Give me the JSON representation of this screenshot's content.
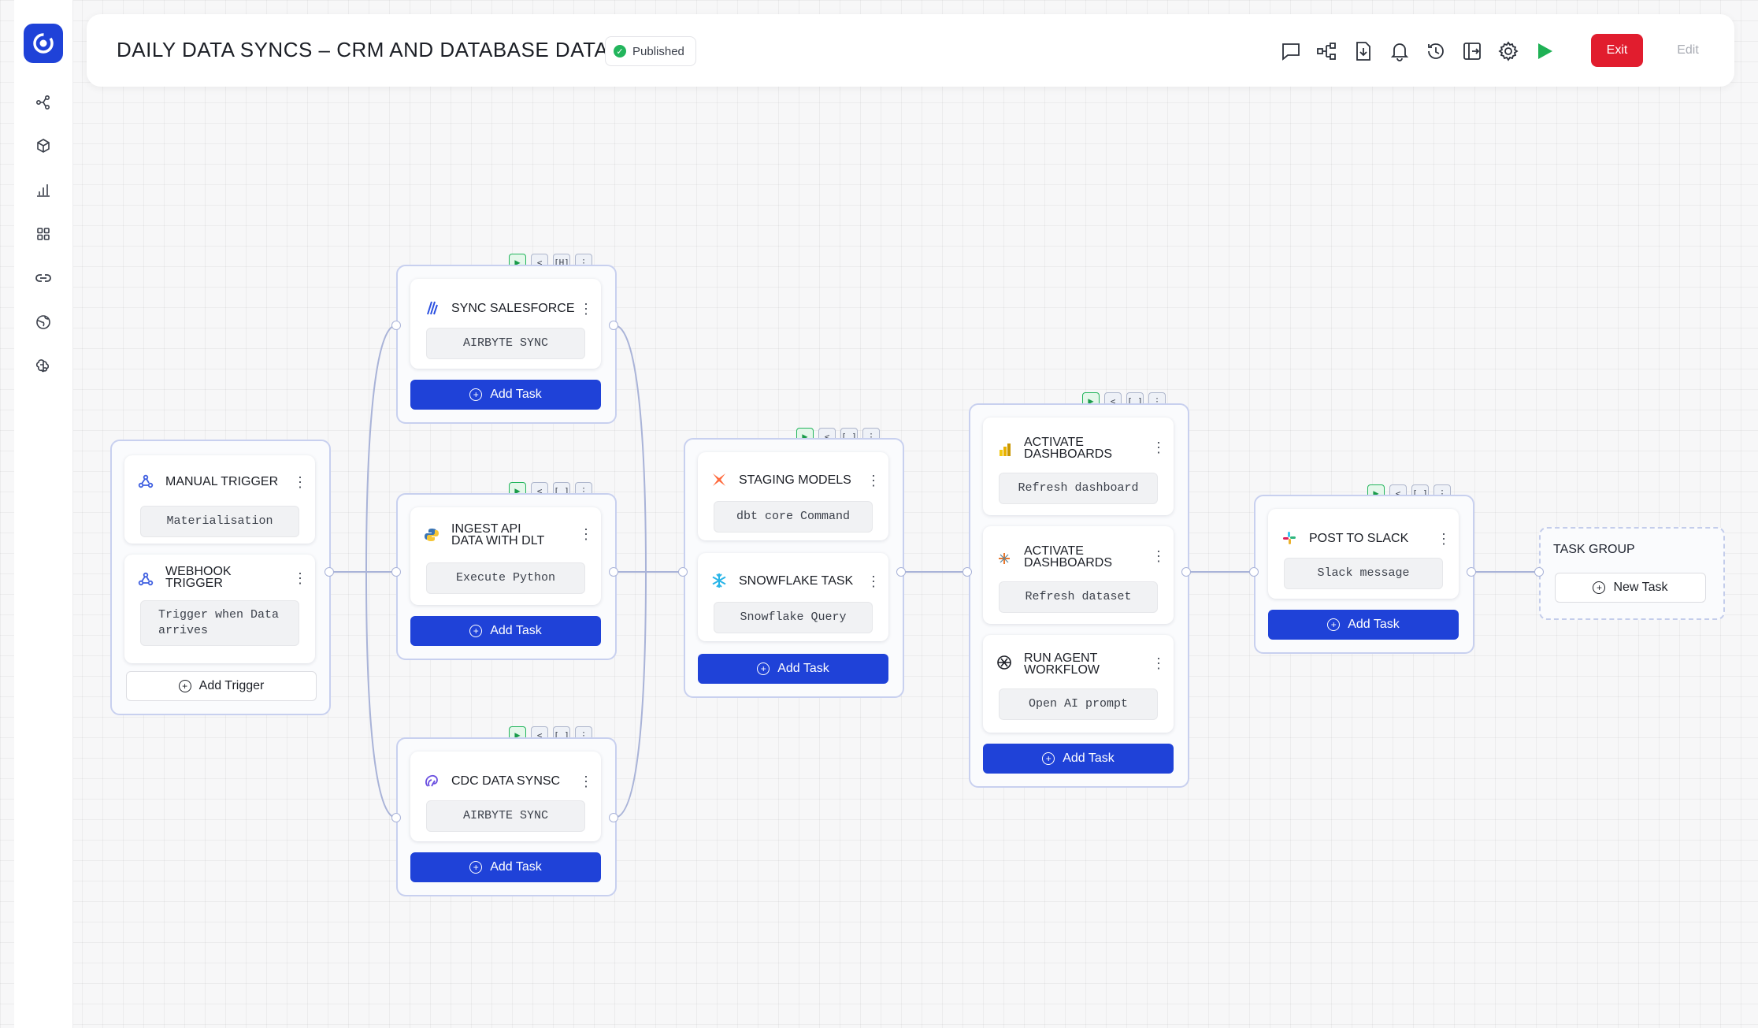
{
  "colors": {
    "accent": "#1f42d8",
    "exit": "#e11d2e",
    "published": "#22b55c",
    "edge": "#a9b3d8"
  },
  "header": {
    "title": "DAILY DATA SYNCS – CRM AND DATABASE DATA",
    "status": "Published",
    "tools": [
      "comment-icon",
      "workflow-icon",
      "download-icon",
      "bell-icon",
      "history-icon",
      "export-icon",
      "settings-icon",
      "run-icon"
    ],
    "exit": "Exit",
    "edit": "Edit"
  },
  "sidebar": {
    "items": [
      "workflow-icon",
      "cube-icon",
      "chart-icon",
      "grid-icon",
      "link-icon",
      "globe-icon",
      "brain-icon"
    ]
  },
  "controls": {
    "play": "▶",
    "share": "<",
    "bracket": "[ ]",
    "bracket_alt": "[H]",
    "more": "⋮"
  },
  "triggers": {
    "manual": {
      "title": "MANUAL TRIGGER",
      "pill": "Materialisation"
    },
    "webhook": {
      "title1": "WEBHOOK",
      "title2": "TRIGGER",
      "pill1": "Trigger when Data",
      "pill2": "arrives"
    },
    "add": "Add Trigger"
  },
  "salesforce": {
    "title": "SYNC SALESFORCE",
    "pill": "AIRBYTE SYNC",
    "add": "Add Task"
  },
  "ingest": {
    "title1": "INGEST API",
    "title2": "DATA WITH DLT",
    "pill": "Execute Python",
    "add": "Add Task"
  },
  "cdc": {
    "title": "CDC DATA SYNSC",
    "pill": "AIRBYTE SYNC",
    "add": "Add Task"
  },
  "staging": {
    "title": "STAGING MODELS",
    "pill": "dbt core Command"
  },
  "snowflake": {
    "title": "SNOWFLAKE TASK",
    "pill": "Snowflake Query",
    "add": "Add Task"
  },
  "activate1": {
    "title1": "ACTIVATE",
    "title2": "DASHBOARDS",
    "pill": "Refresh dashboard"
  },
  "activate2": {
    "title1": "ACTIVATE",
    "title2": "DASHBOARDS",
    "pill": "Refresh dataset"
  },
  "agent": {
    "title1": "RUN AGENT",
    "title2": "WORKFLOW",
    "pill": "Open AI prompt",
    "add": "Add Task"
  },
  "slack": {
    "title": "POST TO SLACK",
    "pill": "Slack message",
    "add": "Add Task"
  },
  "taskgroup": {
    "title": "TASK GROUP",
    "new": "New Task"
  }
}
